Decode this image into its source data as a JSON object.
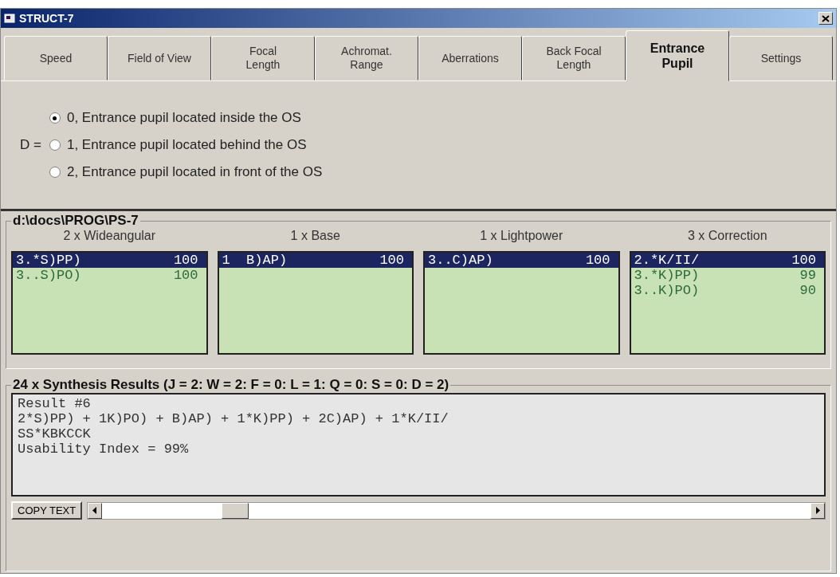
{
  "window": {
    "title": "STRUCT-7"
  },
  "tabs": [
    {
      "label": "Speed",
      "selected": false
    },
    {
      "label": "Field of View",
      "selected": false
    },
    {
      "label": "Focal\nLength",
      "selected": false
    },
    {
      "label": "Achromat.\nRange",
      "selected": false
    },
    {
      "label": "Aberrations",
      "selected": false
    },
    {
      "label": "Back Focal\nLength",
      "selected": false
    },
    {
      "label": "Entrance\nPupil",
      "selected": true
    },
    {
      "label": "Settings",
      "selected": false
    }
  ],
  "option_group": {
    "label": "D =",
    "options": [
      {
        "label": "0, Entrance pupil located inside the OS",
        "selected": true
      },
      {
        "label": "1, Entrance pupil located behind the OS",
        "selected": false
      },
      {
        "label": "2, Entrance pupil located in front of the OS",
        "selected": false
      }
    ]
  },
  "lists_group": {
    "title": "d:\\docs\\PROG\\PS-7",
    "lists": [
      {
        "title": "2 x Wideangular",
        "items": [
          {
            "code": "3.*S)PP)",
            "value": "100",
            "selected": true
          },
          {
            "code": "3..S)PO)",
            "value": "100",
            "selected": false
          }
        ]
      },
      {
        "title": "1 x Base",
        "items": [
          {
            "code": "1  B)AP)",
            "value": "100",
            "selected": true
          }
        ]
      },
      {
        "title": "1 x Lightpower",
        "items": [
          {
            "code": "3..C)AP)",
            "value": "100",
            "selected": true
          }
        ]
      },
      {
        "title": "3 x Correction",
        "items": [
          {
            "code": "2.*K/II/",
            "value": "100",
            "selected": true
          },
          {
            "code": "3.*K)PP)",
            "value": "99",
            "selected": false
          },
          {
            "code": "3..K)PO)",
            "value": "90",
            "selected": false
          }
        ]
      }
    ]
  },
  "results": {
    "title": "24 x Synthesis Results (J = 2: W = 2: F = 0: L = 1: Q = 0: S = 0: D = 2)",
    "lines": [
      "Result #6",
      "2*S)PP) + 1K)PO) + B)AP) + 1*K)PP) + 2C)AP) + 1*K/II/",
      "SS*KBKCCK",
      "Usability Index = 99%"
    ],
    "copy_button": "COPY TEXT"
  }
}
